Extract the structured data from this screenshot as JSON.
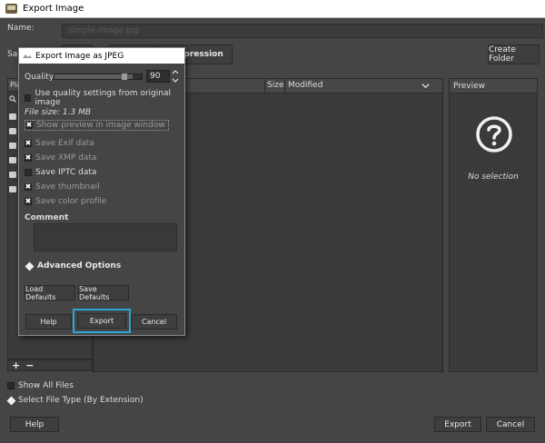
{
  "window": {
    "title": "Export Image"
  },
  "name_row": {
    "label": "Name:",
    "value": "simple-image.jpg"
  },
  "save_in": {
    "label": "Sa",
    "path_buttons": [
      "",
      "",
      "Compression"
    ],
    "create_folder": "Create Folder"
  },
  "places": {
    "header": "Pla"
  },
  "files": {
    "col_size": "Size",
    "col_modified": "Modified"
  },
  "preview": {
    "header": "Preview",
    "empty_text": "No selection"
  },
  "options": {
    "show_all_files": "Show All Files",
    "select_file_type": "Select File Type (By Extension)"
  },
  "bottom": {
    "help": "Help",
    "export": "Export",
    "cancel": "Cancel"
  },
  "jpeg_dialog": {
    "title": "Export Image as JPEG",
    "quality_label": "Quality:",
    "quality_value": "90",
    "quality_fraction": 0.9,
    "use_original_quality": "Use quality settings from original image",
    "file_size": "File size: 1.3 MB",
    "show_preview": "Show preview in image window",
    "save_exif": "Save Exif data",
    "save_xmp": "Save XMP data",
    "save_iptc": "Save IPTC data",
    "save_thumbnail": "Save thumbnail",
    "save_color_profile": "Save color profile",
    "comment_label": "Comment",
    "advanced_options": "Advanced Options",
    "load_defaults": "Load Defaults",
    "save_defaults": "Save Defaults",
    "help": "Help",
    "export": "Export",
    "cancel": "Cancel",
    "check_mark": "✖",
    "checked": {
      "use_original_quality": false,
      "show_preview": true,
      "save_exif": true,
      "save_xmp": true,
      "save_iptc": false,
      "save_thumbnail": true,
      "save_color_profile": true
    }
  },
  "icons": [
    "app-icon",
    "jpeg-dialog-icon",
    "chevron-down-icon",
    "question-icon",
    "add-icon",
    "remove-icon",
    "folder-icon",
    "search-icon"
  ],
  "colors": {
    "background": "#454545",
    "highlight": "#2aa8d8"
  }
}
